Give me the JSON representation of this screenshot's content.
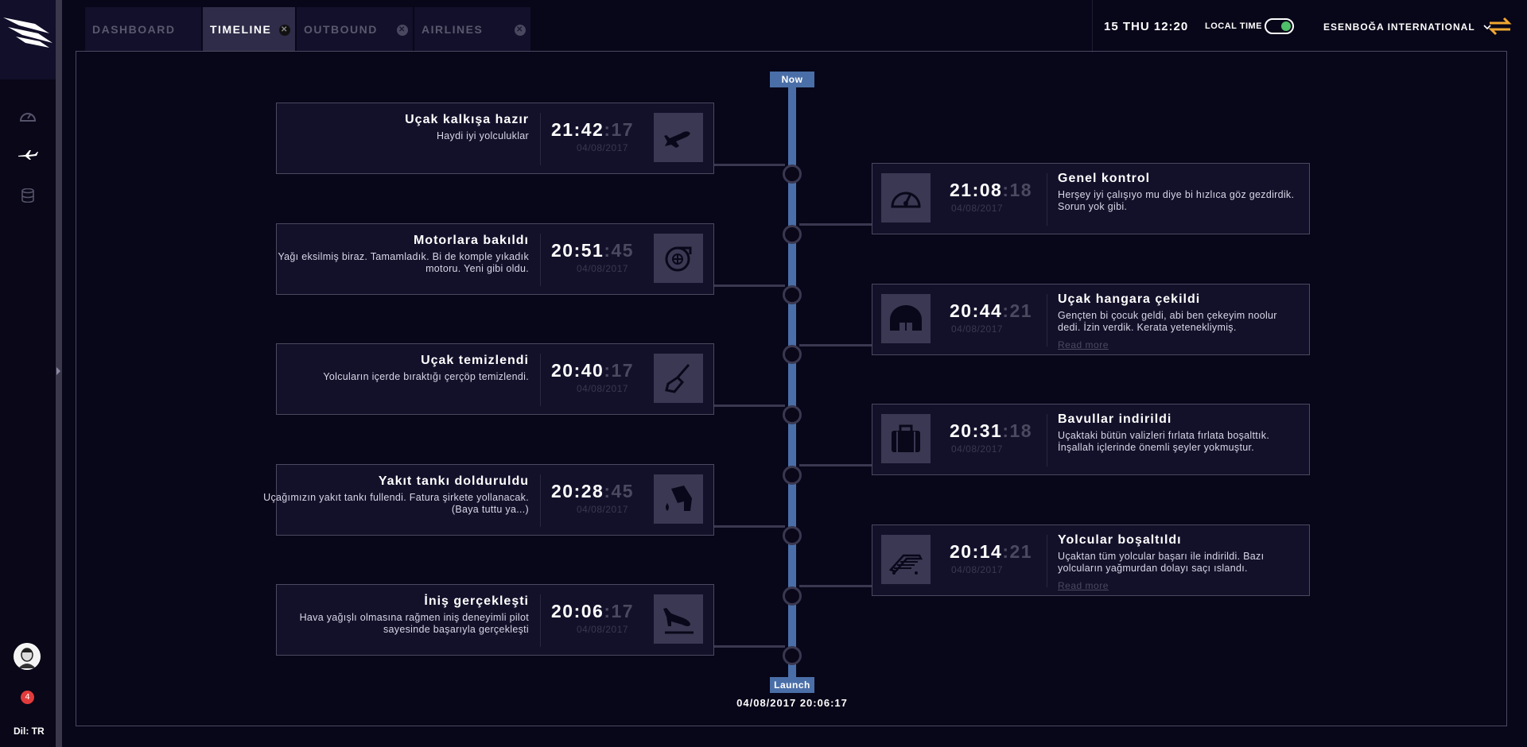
{
  "sidebar": {
    "logo": "airline-logo",
    "items": [
      {
        "icon": "speedometer-icon"
      },
      {
        "icon": "airplane-icon"
      },
      {
        "icon": "database-icon"
      }
    ],
    "notification_count": "4",
    "language": "Dil: TR"
  },
  "tabs": [
    {
      "label": "DASHBOARD",
      "active": false,
      "closable": false
    },
    {
      "label": "TIMELINE",
      "active": true,
      "closable": true
    },
    {
      "label": "OUTBOUND",
      "active": false,
      "closable": true
    },
    {
      "label": "AIRLINES",
      "active": false,
      "closable": true
    }
  ],
  "header": {
    "clock": "15 THU 12:20",
    "local_time_label": "LOCAL TIME",
    "local_time_on": true,
    "airport": "ESENBOĞA INTERNATIONAL",
    "swap_icon": "swap-arrows-icon"
  },
  "timeline": {
    "top_marker": "Now",
    "bottom_marker": "Launch",
    "launch_date": "04/08/2017 20:06:17",
    "colors": {
      "spine": "#4a6fa8",
      "accent_icon": "#f0a830"
    },
    "events": [
      {
        "side": "left",
        "title": "Uçak kalkışa hazır",
        "desc": "Haydi iyi yolculuklar",
        "time": "21:42",
        "sec": ":17",
        "date": "04/08/2017",
        "icon": "airplane-takeoff-icon",
        "read_more": ""
      },
      {
        "side": "right",
        "title": "Genel kontrol",
        "desc": "Herşey iyi çalışıyo mu diye bi hızlıca göz gezdirdik. Sorun yok gibi.",
        "time": "21:08",
        "sec": ":18",
        "date": "04/08/2017",
        "icon": "speedometer-icon",
        "read_more": ""
      },
      {
        "side": "left",
        "title": "Motorlara bakıldı",
        "desc": "Yağı eksilmiş biraz. Tamamladık. Bi de komple yıkadık motoru. Yeni gibi oldu.",
        "time": "20:51",
        "sec": ":45",
        "date": "04/08/2017",
        "icon": "turbine-icon",
        "read_more": ""
      },
      {
        "side": "right",
        "title": "Uçak hangara çekildi",
        "desc": "Gençten bi çocuk geldi, abi ben çekeyim noolur dedi. İzin verdik. Kerata yetenekliymiş.",
        "time": "20:44",
        "sec": ":21",
        "date": "04/08/2017",
        "icon": "hangar-icon",
        "read_more": "Read more"
      },
      {
        "side": "left",
        "title": "Uçak temizlendi",
        "desc": "Yolcuların içerde bıraktığı çerçöp temizlendi.",
        "time": "20:40",
        "sec": ":17",
        "date": "04/08/2017",
        "icon": "broom-icon",
        "read_more": ""
      },
      {
        "side": "right",
        "title": "Bavullar indirildi",
        "desc": "Uçaktaki bütün valizleri fırlata fırlata boşalttık. İnşallah içlerinde önemli şeyler yokmuştur.",
        "time": "20:31",
        "sec": ":18",
        "date": "04/08/2017",
        "icon": "suitcase-icon",
        "read_more": ""
      },
      {
        "side": "left",
        "title": "Yakıt tankı dolduruldu",
        "desc": "Uçağımızın yakıt tankı fullendi. Fatura şirkete yollanacak. (Baya tuttu ya...)",
        "time": "20:28",
        "sec": ":45",
        "date": "04/08/2017",
        "icon": "fuel-nozzle-icon",
        "read_more": ""
      },
      {
        "side": "right",
        "title": "Yolcular boşaltıldı",
        "desc": "Uçaktan tüm yolcular başarı ile indirildi. Bazı yolcuların yağmurdan dolayı saçı ıslandı.",
        "time": "20:14",
        "sec": ":21",
        "date": "04/08/2017",
        "icon": "airstairs-icon",
        "read_more": "Read more"
      },
      {
        "side": "left",
        "title": "İniş gerçekleşti",
        "desc": "Hava yağışlı olmasına rağmen iniş deneyimli pilot sayesinde başarıyla gerçekleşti",
        "time": "20:06",
        "sec": ":17",
        "date": "04/08/2017",
        "icon": "airplane-landing-icon",
        "read_more": ""
      }
    ]
  }
}
